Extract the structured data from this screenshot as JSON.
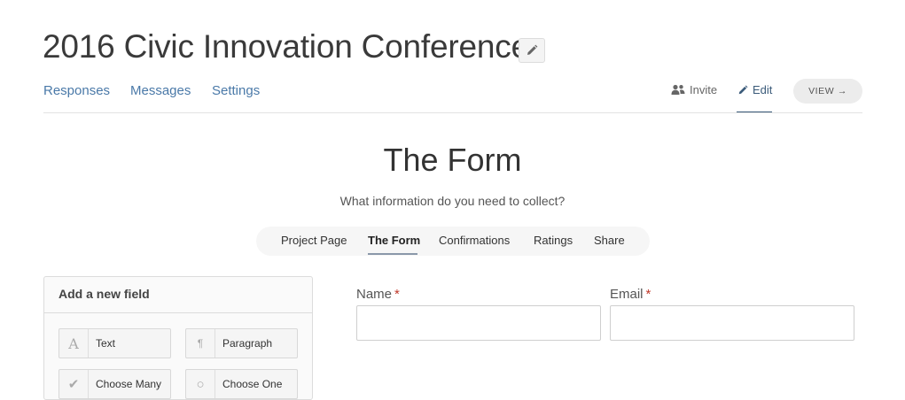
{
  "project": {
    "title": "2016 Civic Innovation Conference"
  },
  "nav": {
    "responses": "Responses",
    "messages": "Messages",
    "settings": "Settings"
  },
  "actions": {
    "invite": "Invite",
    "edit": "Edit",
    "view": "VIEW →"
  },
  "section": {
    "heading": "The Form",
    "subtitle": "What information do you need to collect?"
  },
  "tabs": [
    {
      "label": "Project Page"
    },
    {
      "label": "The Form",
      "active": true
    },
    {
      "label": "Confirmations"
    },
    {
      "label": "Ratings"
    },
    {
      "label": "Share"
    }
  ],
  "add_field": {
    "title": "Add a new field",
    "types": [
      {
        "label": "Text",
        "icon": "letter-a-icon"
      },
      {
        "label": "Paragraph",
        "icon": "pilcrow-icon"
      },
      {
        "label": "Choose Many",
        "icon": "checkmark-icon"
      },
      {
        "label": "Choose One",
        "icon": "radio-circle-icon"
      }
    ]
  },
  "form_fields": [
    {
      "label": "Name",
      "required_marker": "*",
      "value": ""
    },
    {
      "label": "Email",
      "required_marker": "*",
      "value": ""
    }
  ],
  "colors": {
    "link": "#4a79a8",
    "required": "#c0392b",
    "edit_underline": "#3b5b7a"
  }
}
